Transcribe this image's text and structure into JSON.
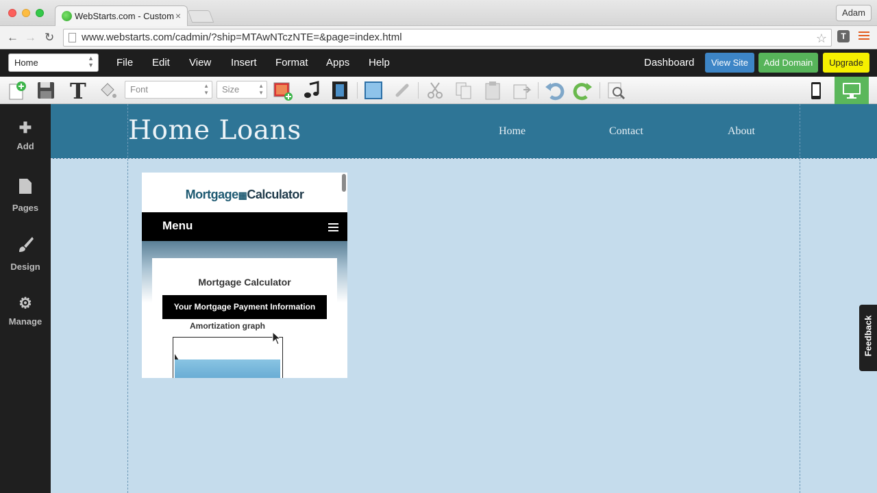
{
  "browser": {
    "tab_title": "WebStarts.com - Custom W",
    "user_name": "Adam",
    "url": "www.webstarts.com/cadmin/?ship=MTAwNTczNTE=&page=index.html"
  },
  "appbar": {
    "page_select": "Home",
    "menu": [
      "File",
      "Edit",
      "View",
      "Insert",
      "Format",
      "Apps",
      "Help"
    ],
    "dashboard": "Dashboard",
    "view_site": "View Site",
    "add_domain": "Add Domain",
    "upgrade": "Upgrade",
    "colors": {
      "view_site": "#3d85c6",
      "add_domain": "#57b45a",
      "upgrade": "#f6f000"
    }
  },
  "toolbar": {
    "font_placeholder": "Font",
    "size_placeholder": "Size",
    "icons": [
      "new-page-icon",
      "save-icon",
      "text-icon",
      "paint-bucket-icon",
      "image-icon",
      "music-icon",
      "video-icon",
      "box-icon",
      "link-icon",
      "cut-icon",
      "copy-icon",
      "paste-icon",
      "paste-special-icon",
      "undo-icon",
      "redo-icon",
      "preview-icon",
      "mobile-icon",
      "desktop-icon"
    ]
  },
  "sidebar": {
    "items": [
      {
        "label": "Add",
        "icon": "plus-icon"
      },
      {
        "label": "Pages",
        "icon": "page-icon"
      },
      {
        "label": "Design",
        "icon": "brush-icon"
      },
      {
        "label": "Manage",
        "icon": "gear-icon"
      }
    ]
  },
  "site": {
    "title": "Home Loans",
    "nav": [
      "Home",
      "Contact",
      "About"
    ],
    "header_color": "#2e7596",
    "background": "#c5dcec"
  },
  "widget": {
    "logo_a": "Mortgage",
    "logo_b": "Calculator",
    "menu_label": "Menu",
    "card_title": "Mortgage Calculator",
    "payment_info": "Your Mortgage Payment Information",
    "amortization": "Amortization graph"
  },
  "feedback": "Feedback"
}
